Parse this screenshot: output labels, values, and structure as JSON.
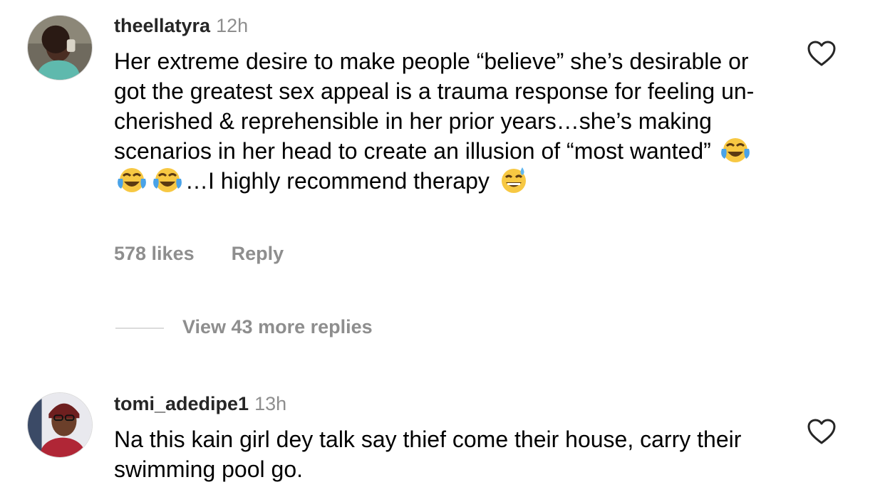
{
  "comments": [
    {
      "username": "theellatyra",
      "time": "12h",
      "text_parts": [
        "Her extreme desire to make people “believe” she’s desirable or got the greatest sex appeal is a trauma response for feeling un-cherished & reprehensible in her prior years…she’s making scenarios in her head to create an illusion of “most wanted” ",
        "…I highly recommend therapy "
      ],
      "emojis": [
        "face-with-tears-of-joy",
        "face-with-tears-of-joy",
        "face-with-tears-of-joy",
        "grinning-face-with-sweat"
      ],
      "likes": "578 likes",
      "reply_label": "Reply",
      "view_replies": "View 43 more replies"
    },
    {
      "username": "tomi_adedipe1",
      "time": "13h",
      "text": "Na this kain girl dey talk say thief come their house, carry their swimming pool go."
    }
  ],
  "icons": {
    "like": "heart-outline-icon"
  },
  "colors": {
    "secondary_text": "#8e8e8e",
    "divider": "#dbdbdb",
    "primary_text": "#000000"
  }
}
